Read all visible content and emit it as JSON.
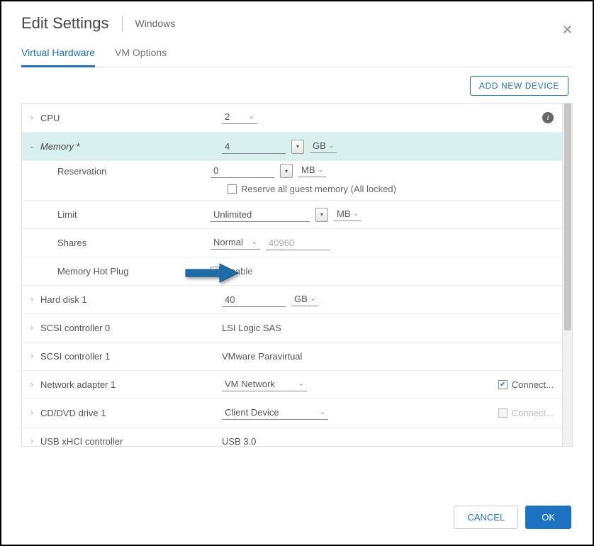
{
  "header": {
    "title": "Edit Settings",
    "subtitle": "Windows"
  },
  "tabs": {
    "hardware": "Virtual Hardware",
    "options": "VM Options"
  },
  "buttons": {
    "add_device": "ADD NEW DEVICE",
    "cancel": "CANCEL",
    "ok": "OK"
  },
  "rows": {
    "cpu": {
      "label": "CPU",
      "value": "2"
    },
    "memory": {
      "label": "Memory *",
      "value": "4",
      "unit": "GB"
    },
    "reservation": {
      "label": "Reservation",
      "value": "0",
      "unit": "MB",
      "checkbox_label": "Reserve all guest memory (All locked)"
    },
    "limit": {
      "label": "Limit",
      "value": "Unlimited",
      "unit": "MB"
    },
    "shares": {
      "label": "Shares",
      "mode": "Normal",
      "value": "40960"
    },
    "hotplug": {
      "label": "Memory Hot Plug",
      "checkbox_label": "Enable"
    },
    "hdd": {
      "label": "Hard disk 1",
      "value": "40",
      "unit": "GB"
    },
    "scsi0": {
      "label": "SCSI controller 0",
      "value": "LSI Logic SAS"
    },
    "scsi1": {
      "label": "SCSI controller 1",
      "value": "VMware Paravirtual"
    },
    "net": {
      "label": "Network adapter 1",
      "value": "VM Network",
      "connect": "Connect..."
    },
    "cd": {
      "label": "CD/DVD drive 1",
      "value": "Client Device",
      "connect": "Connect..."
    },
    "usb": {
      "label": "USB xHCI controller",
      "value": "USB 3.0"
    }
  }
}
